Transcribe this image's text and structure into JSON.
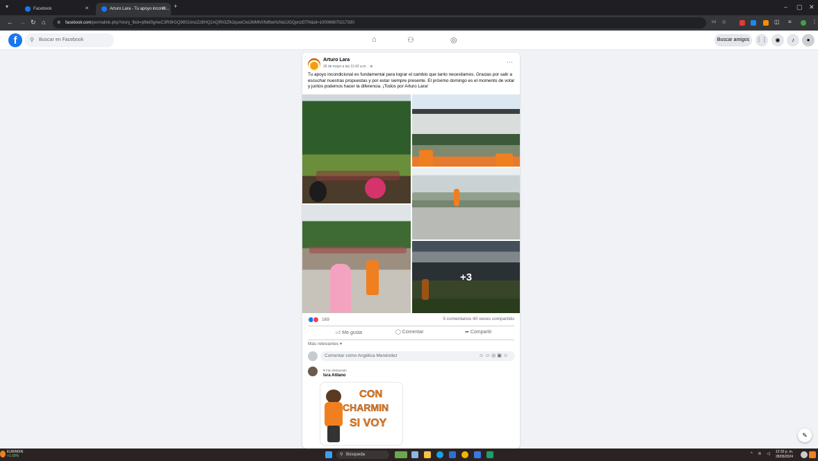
{
  "browser": {
    "tabs": [
      {
        "label": "Facebook",
        "active": false
      },
      {
        "label": "Arturo Lara - Tu apoyo incondi...",
        "active": true
      }
    ],
    "new_tab": "+",
    "url_host": "facebook.com",
    "url_path": "/permalink.php?story_fbid=pfbid0gAwC3Ri9rGQ98S1imzZzBHQ2AQRh3Zfk2quwCkdJMMhXftdfbeHzNdJJGQpnzEf7N&id=100066670217330",
    "window_controls": [
      "–",
      "▢",
      "✕"
    ]
  },
  "facebook_header": {
    "logo": "f",
    "search_placeholder": "Buscar en Facebook",
    "find_friends_label": "Buscar amigos",
    "nav_icons": [
      "home-icon",
      "friends-icon",
      "groups-icon"
    ],
    "right_icons": [
      "menu-grid-icon",
      "messenger-icon",
      "bell-icon",
      "profile-icon"
    ]
  },
  "post": {
    "author": "Arturo Lara",
    "date": "26 de mayo a las 11:42 a.m. · ",
    "menu": "···",
    "text": "Tu apoyo incondicional es fundamental para lograr el cambio que tanto necesitamos. Gracias por salir a escuchar nuestras propuestas y por estar siempre presente. El próximo domingo es el momento de votar y juntos podemos hacer la diferencia. ¡Todos por Arturo Lara!",
    "more_photos": "+3",
    "reaction_count": "169",
    "comment_share_counts": "5 comentarios  40 veces compartido",
    "actions": {
      "like": "Me gusta",
      "comment": "Comentar",
      "share": "Compartir"
    },
    "sort_label": "Más relevantes ▾",
    "comment_placeholder": "Comentar como Angélica Menéndez",
    "comment": {
      "badge": "Fan destacado",
      "author": "Isra Atilano",
      "sticker_lines": [
        "CON",
        "CHARMIN",
        "SI VOY"
      ]
    }
  },
  "taskbar": {
    "ticker_name": "EUR/MXN",
    "ticker_change": "+1.09%",
    "search_label": "Búsqueda",
    "time": "12:32 p. m.",
    "date": "28/05/2024"
  },
  "colors": {
    "facebook_blue": "#1877f2",
    "like_blue": "#1877f2",
    "love_red": "#f33e58",
    "orange_shirts": "#f07f1f"
  }
}
